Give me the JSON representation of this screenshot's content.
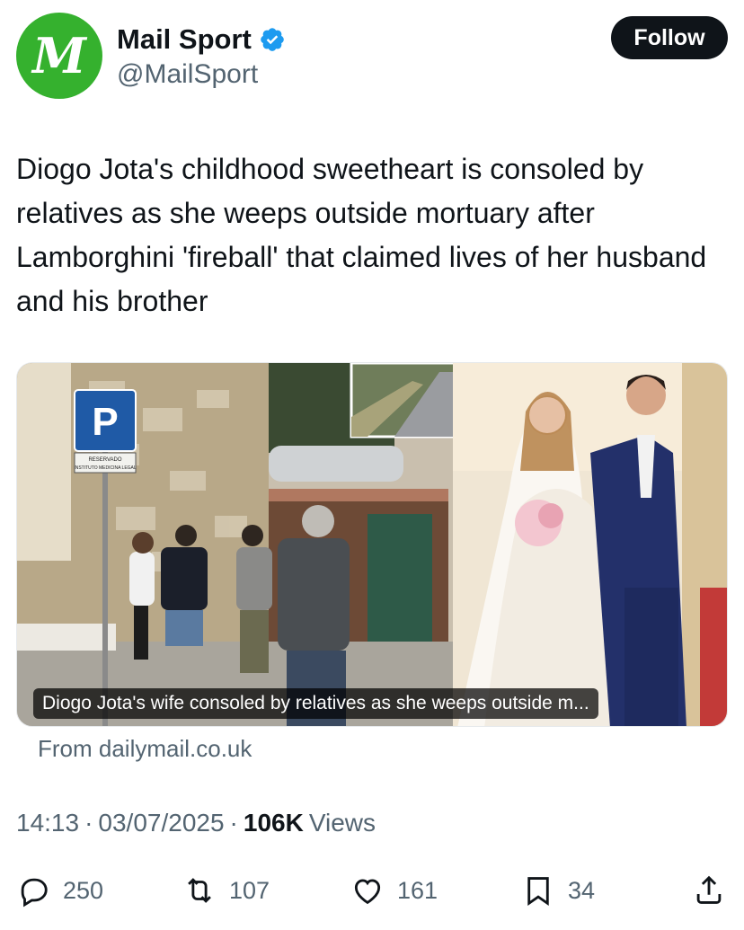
{
  "account": {
    "name": "Mail Sport",
    "handle": "@MailSport",
    "avatar_letter": "M",
    "avatar_color": "#35b12e",
    "verified": true,
    "verified_color": "#1d9bf0"
  },
  "follow_label": "Follow",
  "tweet_text": "Diogo Jota's childhood sweetheart is consoled by relatives as she weeps outside mortuary after Lamborghini 'fireball' that claimed lives of her husband and his brother",
  "card": {
    "caption": "Diogo Jota's wife consoled by relatives as she weeps outside m...",
    "source": "From dailymail.co.uk",
    "sign_parking": "P",
    "sign_text_1": "RESERVADO",
    "sign_text_2": "INSTITUTO MEDICINA LEGAL"
  },
  "meta": {
    "time": "14:13",
    "separator": "·",
    "date": "03/07/2025",
    "views_count": "106K",
    "views_label": "Views"
  },
  "actions": {
    "replies": "250",
    "reposts": "107",
    "likes": "161",
    "bookmarks": "34"
  },
  "icons": {
    "reply": "reply-icon",
    "repost": "repost-icon",
    "like": "heart-icon",
    "bookmark": "bookmark-icon",
    "share": "share-icon"
  }
}
